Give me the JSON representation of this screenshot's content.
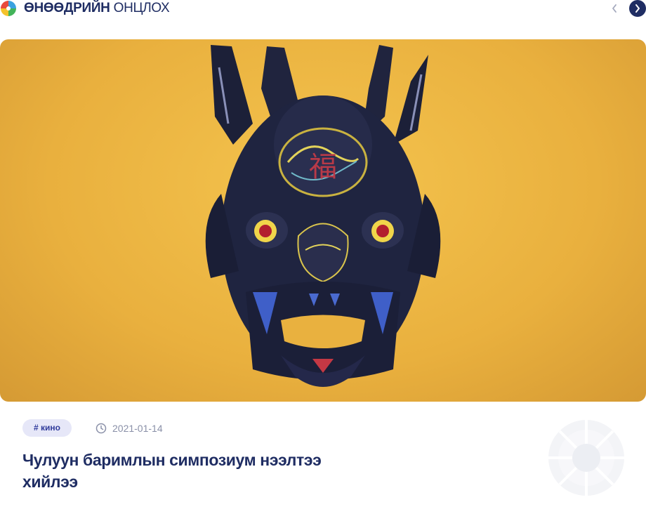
{
  "header": {
    "title_bold": "ӨНӨӨДРИЙН",
    "title_light": "ОНЦЛОХ",
    "prev_icon": "chevron-left-icon",
    "next_icon": "chevron-right-icon"
  },
  "article": {
    "tag": "# кино",
    "date": "2021-01-14",
    "title": "Чулуун баримлын симпозиум нээлтээ хийлээ"
  },
  "colors": {
    "brand": "#1f2d63",
    "tag_bg": "#e6e7f8",
    "tag_text": "#2f3a9b",
    "date_text": "#8a90a8",
    "hero_bg": "#eeb945"
  }
}
